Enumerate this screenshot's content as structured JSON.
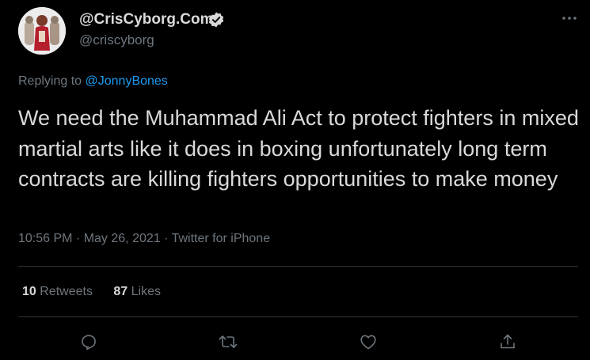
{
  "author": {
    "display_name": "@CrisCyborg.Com",
    "handle": "@criscyborg",
    "verified": true
  },
  "reply": {
    "prefix": "Replying to ",
    "mention": "@JonnyBones"
  },
  "tweet": {
    "text": "We need the Muhammad Ali Act to protect fighters in mixed martial arts like it does in boxing unfortunately long term contracts are killing fighters opportunities to make money",
    "time": "10:56 PM",
    "date": "May 26, 2021",
    "source": "Twitter for iPhone",
    "separator": " · "
  },
  "stats": {
    "retweets_count": "10",
    "retweets_label": " Retweets",
    "likes_count": "87",
    "likes_label": " Likes"
  },
  "icons": {
    "more": "more-icon",
    "reply": "reply-icon",
    "retweet": "retweet-icon",
    "like": "heart-icon",
    "share": "share-icon",
    "verified": "verified-badge-icon"
  },
  "colors": {
    "background": "#000000",
    "text": "#d9d9d9",
    "muted": "#6e767d",
    "accent": "#1d9bf0"
  }
}
